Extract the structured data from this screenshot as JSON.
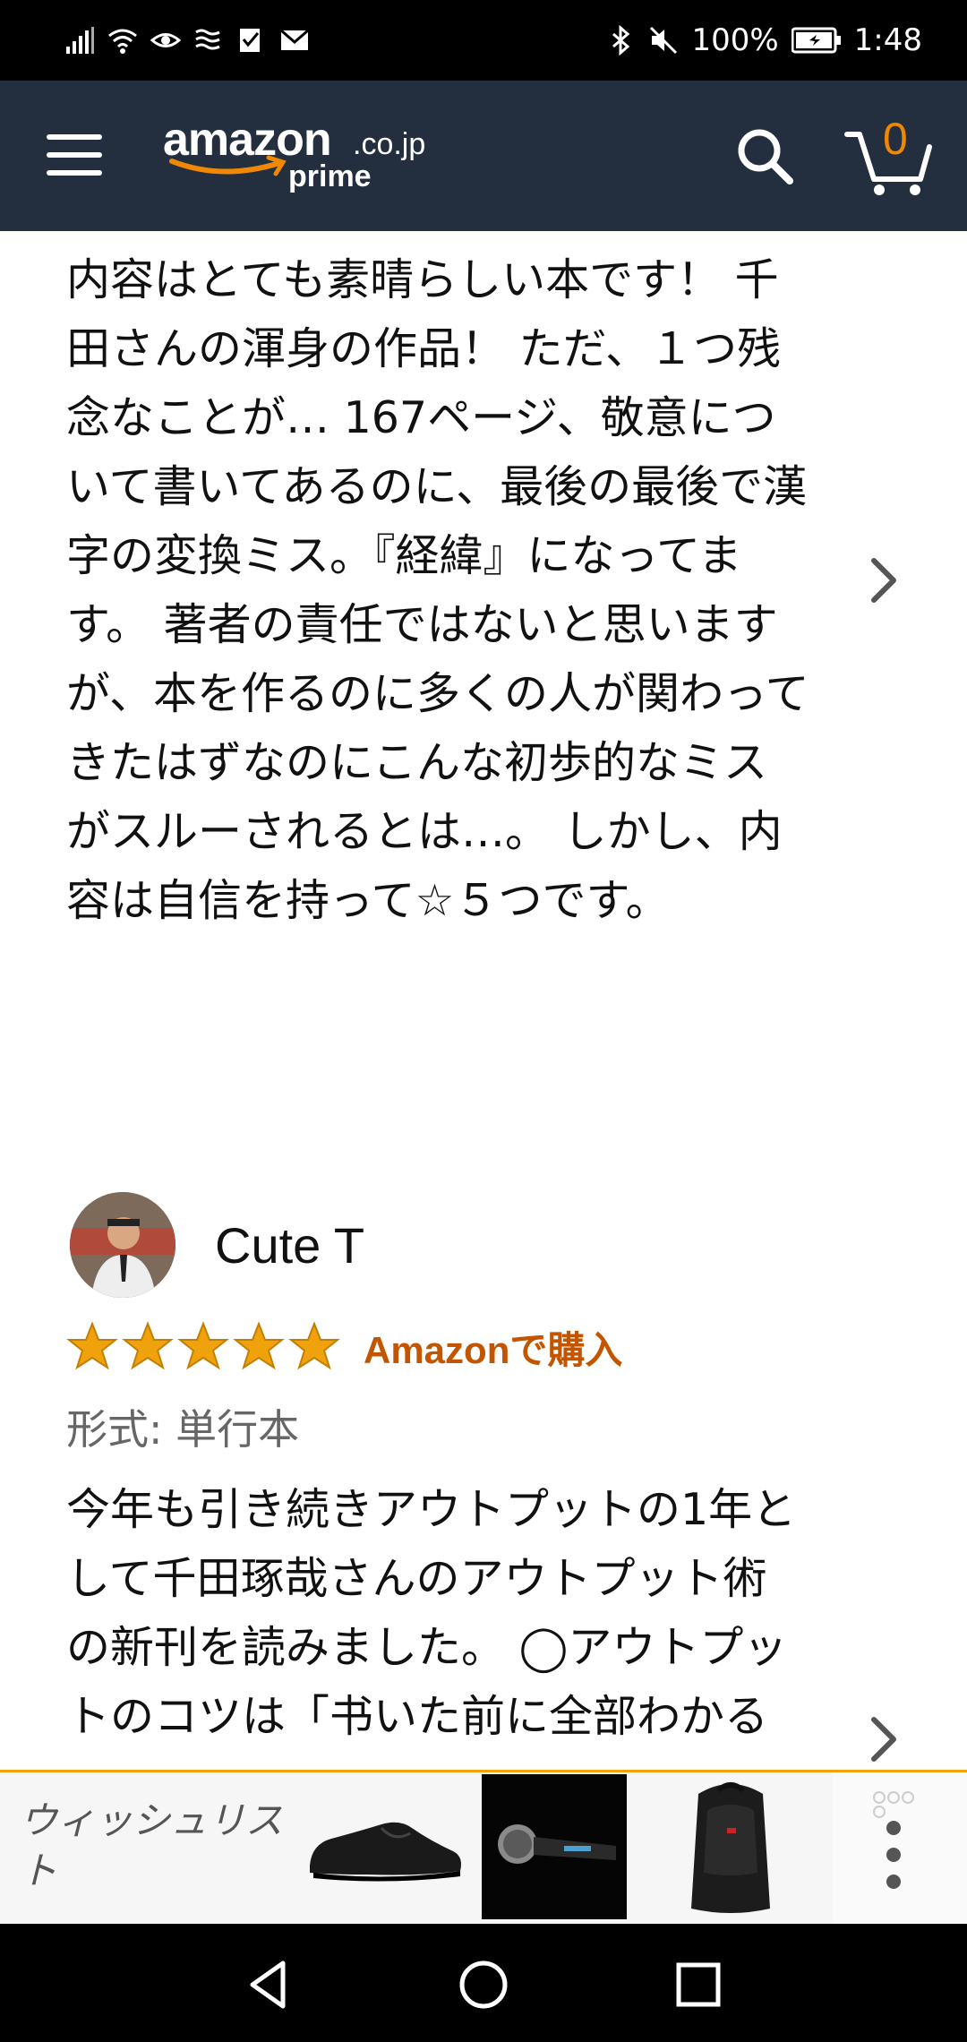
{
  "status_bar": {
    "battery": "100%",
    "time": "1:48"
  },
  "header": {
    "logo_main": "amazon",
    "logo_domain": ".co.jp",
    "logo_prime": "prime",
    "cart_count": "0",
    "accent_color": "#f08804",
    "background_color": "#232f3e"
  },
  "reviews": [
    {
      "text": "内容はとても素晴らしい本です！ 千田さんの渾身の作品！ ただ、１つ残念なことが… 167ページ、敬意について書いてあるのに、最後の最後で漢字の変換ミス。『経緯』になってます。 著者の責任ではないと思いますが、本を作るのに多くの人が関わってきたはずなのにこんな初歩的なミスがスルーされるとは…。 しかし、内容は自信を持って☆５つです。"
    },
    {
      "reviewer": "Cute T",
      "stars": 5,
      "verified": "Amazonで購入",
      "format": "形式: 単行本",
      "text": "今年も引き続きアウトプットの1年として千田琢哉さんのアウトプット術の新刊を読みました。 ◯アウトプットのコツは「书いた前に全部わかる"
    }
  ],
  "wishlist": {
    "label": "ウィッシュリスト",
    "items": [
      "dress-shoe",
      "karaoke-microphone",
      "backpack"
    ]
  },
  "colors": {
    "star": "#f0a20c",
    "verified": "#c45500",
    "wishlist_border": "#f0a30a"
  }
}
